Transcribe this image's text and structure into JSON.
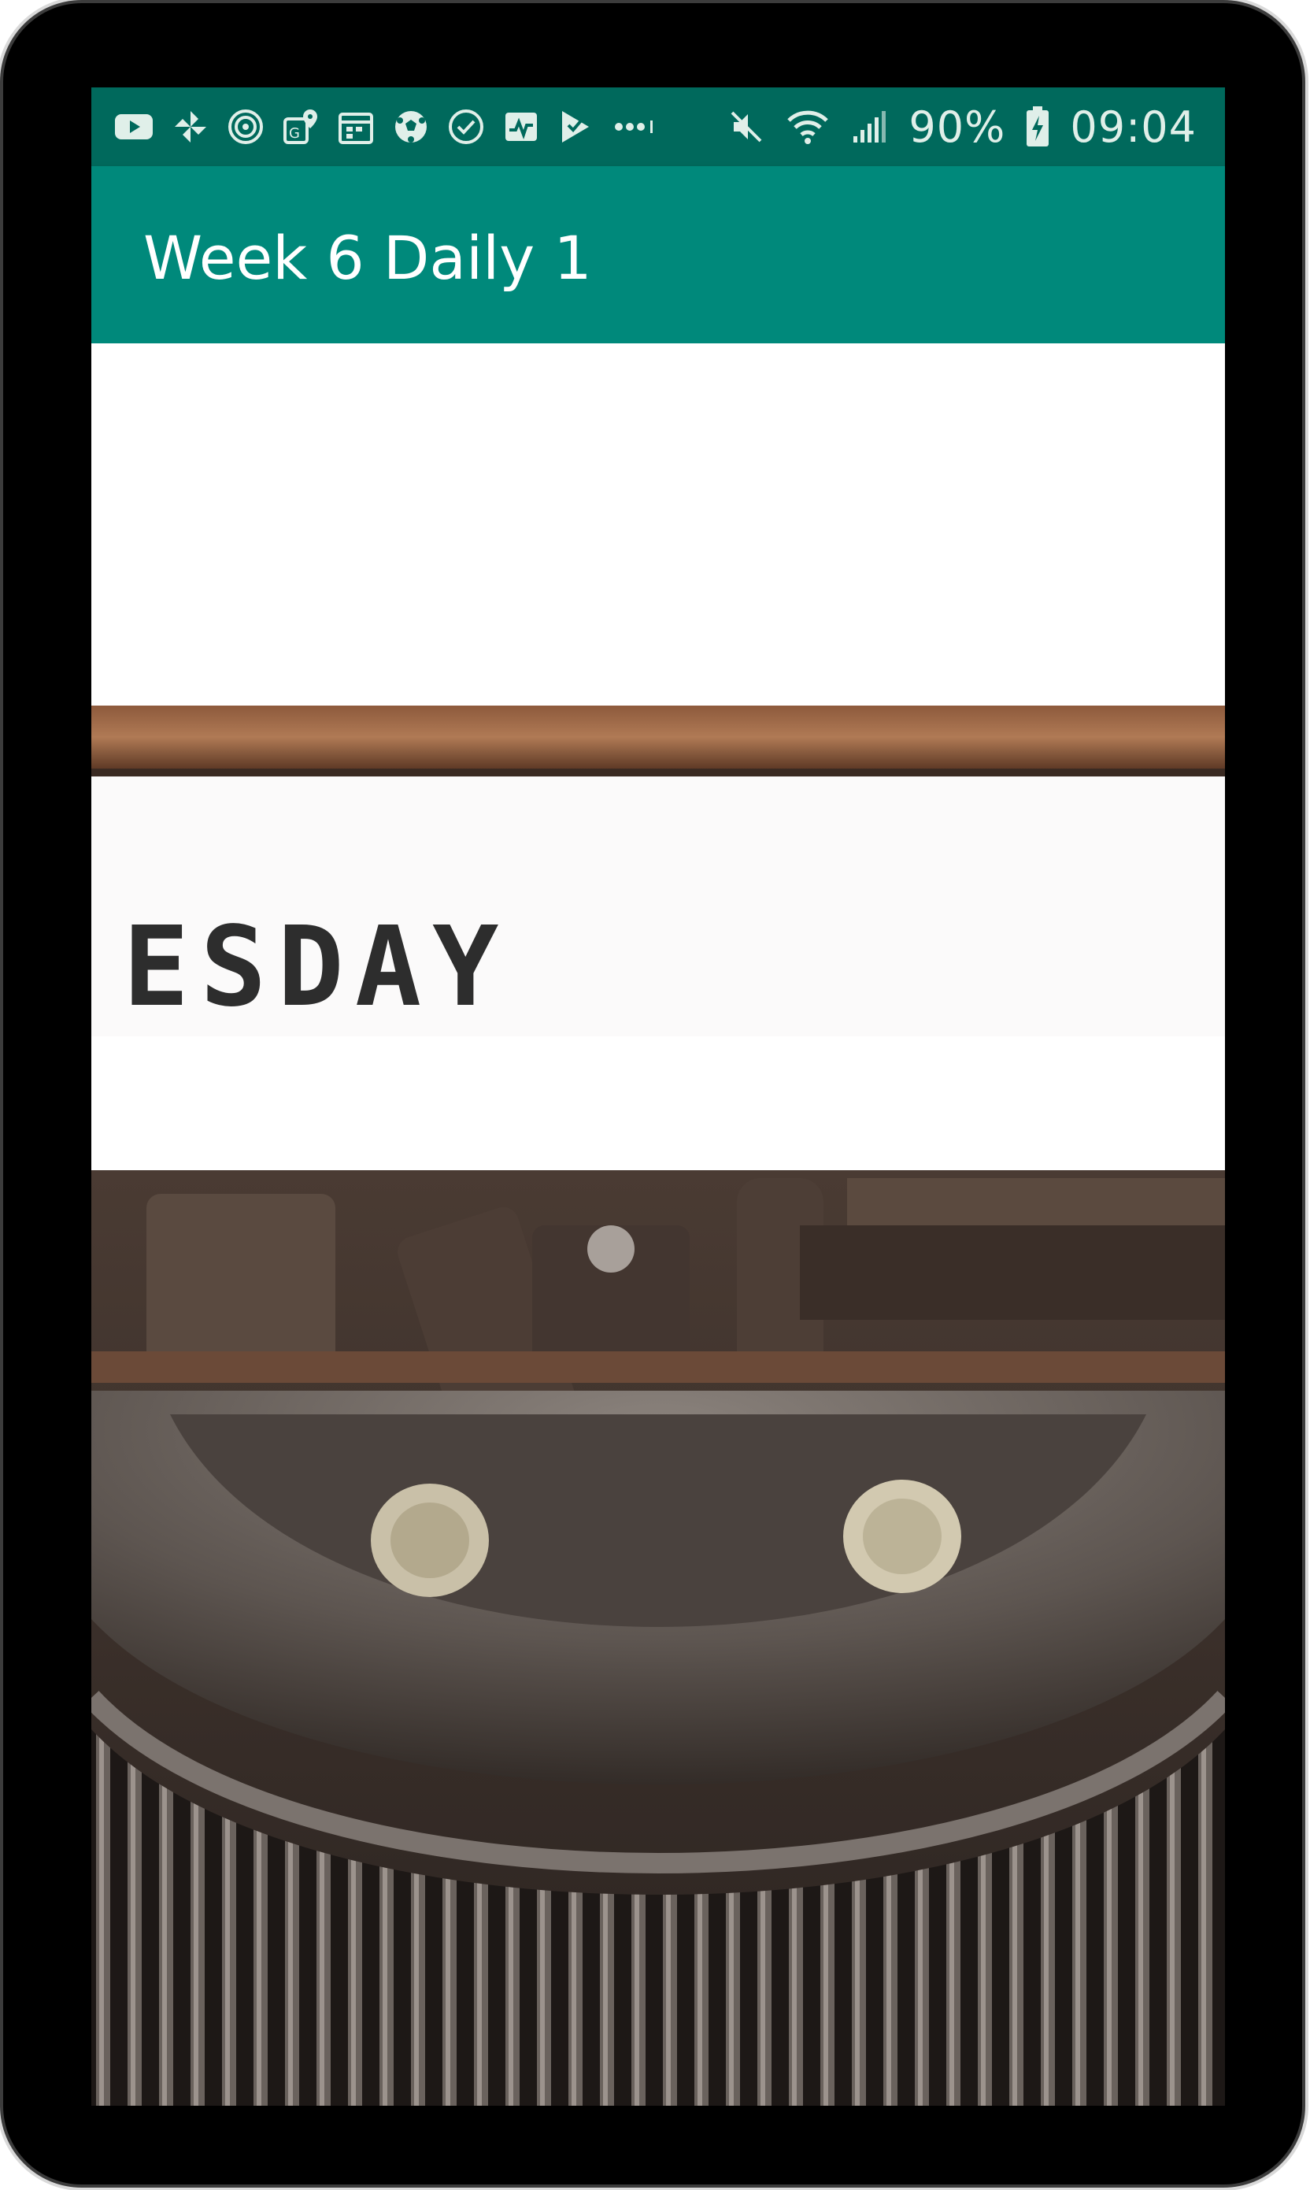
{
  "status_bar": {
    "notification_icons": [
      "youtube-icon",
      "pinwheel-icon",
      "signal-rings-icon",
      "map-pin-icon",
      "calendar-icon",
      "soccer-ball-icon",
      "check-circle-icon",
      "activity-icon",
      "checklist-icon",
      "more-dots-icon"
    ],
    "battery_percent": "90%",
    "time": "09:04",
    "colors": {
      "background": "#00695c",
      "foreground": "#e0efe9"
    }
  },
  "app_bar": {
    "title": "Week 6 Daily 1",
    "color": "#00897b"
  },
  "content": {
    "image": {
      "subject": "typewriter-photo",
      "typed_text": "ESDAY"
    }
  }
}
